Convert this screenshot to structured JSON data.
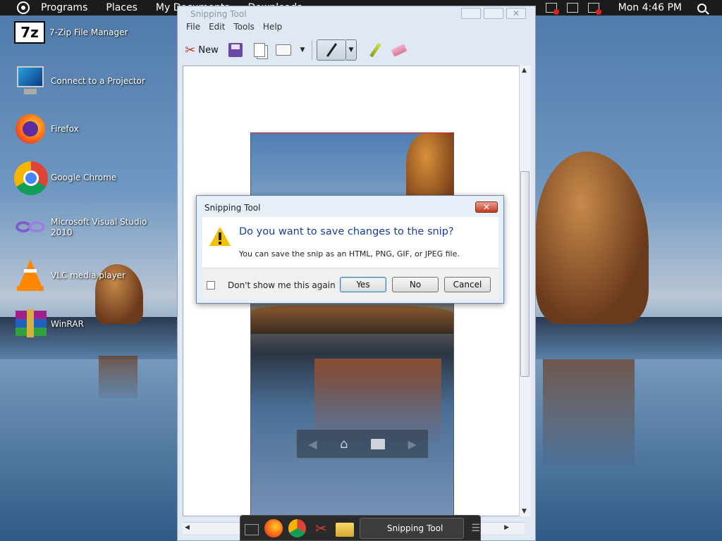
{
  "panel": {
    "menus": [
      "Programs",
      "Places",
      "My Documents",
      "Downloads"
    ],
    "clock": "Mon 4:46 PM"
  },
  "desktop_icons": [
    {
      "label": "7-Zip File Manager",
      "icon": "sevenzip-icon"
    },
    {
      "label": "Connect to a Projector",
      "icon": "projector-icon"
    },
    {
      "label": "Firefox",
      "icon": "firefox-icon"
    },
    {
      "label": "Google Chrome",
      "icon": "chrome-icon"
    },
    {
      "label": "Microsoft Visual Studio 2010",
      "icon": "visual-studio-icon"
    },
    {
      "label": "VLC media player",
      "icon": "vlc-icon"
    },
    {
      "label": "WinRAR",
      "icon": "winrar-icon"
    }
  ],
  "snipping": {
    "title": "Snipping Tool",
    "menu": [
      "File",
      "Edit",
      "Tools",
      "Help"
    ],
    "new_label": "New"
  },
  "dialog": {
    "title": "Snipping Tool",
    "heading": "Do you want to save changes to the snip?",
    "message": "You can save the snip as an HTML, PNG, GIF, or JPEG file.",
    "checkbox_label": "Don't show me this again",
    "yes": "Yes",
    "no": "No",
    "cancel": "Cancel"
  },
  "taskbar": {
    "active_task": "Snipping Tool"
  },
  "colors": {
    "accent_heading": "#1a3d9c",
    "close_red": "#c33a22",
    "panel_bg": "#1b1b1b"
  }
}
